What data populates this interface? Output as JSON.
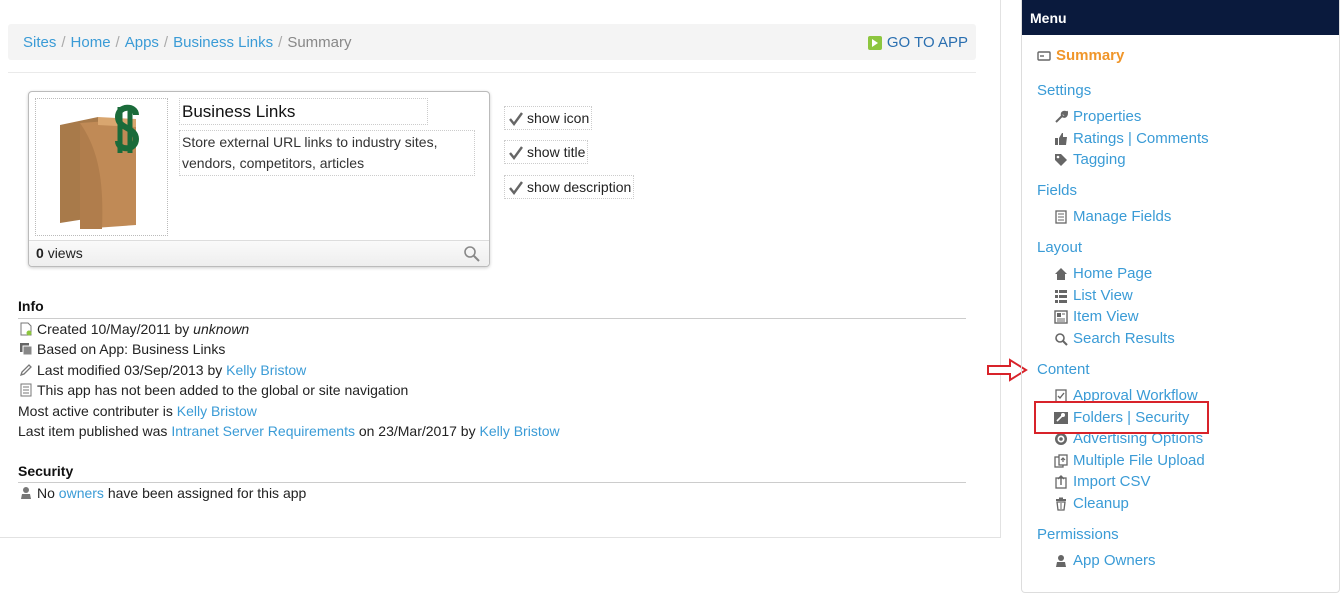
{
  "breadcrumb": {
    "items": [
      "Sites",
      "Home",
      "Apps",
      "Business Links"
    ],
    "separator": "/",
    "current": "Summary"
  },
  "goto_app_label": "GO TO APP",
  "app": {
    "title": "Business Links",
    "description": "Store external URL links to industry sites, vendors, competitors, articles",
    "views_count": "0",
    "views_label": "views"
  },
  "display_options": [
    {
      "label": "show icon",
      "checked": true
    },
    {
      "label": "show title",
      "checked": true
    },
    {
      "label": "show description",
      "checked": true
    }
  ],
  "info": {
    "title": "Info",
    "created_prefix": "Created 10/May/2011 by",
    "created_by": "unknown",
    "based_on": "Based on App: Business Links",
    "modified_prefix": "Last modified 03/Sep/2013 by",
    "modified_by": "Kelly Bristow",
    "navigation_note": "This app has not been added to the global or site navigation",
    "contributor_prefix": "Most active contributer is",
    "contributor": "Kelly Bristow",
    "published_prefix": "Last item published was",
    "published_item": "Intranet Server Requirements",
    "published_mid": "on 23/Mar/2017 by",
    "published_by": "Kelly Bristow"
  },
  "security": {
    "title": "Security",
    "prefix": "No",
    "owners_link": "owners",
    "suffix": "have been assigned for this app"
  },
  "menu": {
    "title": "Menu",
    "summary": "Summary",
    "settings": {
      "label": "Settings",
      "items": [
        "Properties",
        "Ratings | Comments",
        "Tagging"
      ]
    },
    "fields": {
      "label": "Fields",
      "items": [
        "Manage Fields"
      ]
    },
    "layout": {
      "label": "Layout",
      "items": [
        "Home Page",
        "List View",
        "Item View",
        "Search Results"
      ]
    },
    "content": {
      "label": "Content",
      "items": [
        "Approval Workflow",
        "Folders | Security",
        "Advertising Options",
        "Multiple File Upload",
        "Import CSV",
        "Cleanup"
      ]
    },
    "permissions": {
      "label": "Permissions",
      "items": [
        "App Owners"
      ]
    }
  },
  "colors": {
    "link": "#3a9bd6",
    "menu_header": "#0a1a3d",
    "summary_active": "#f0962a",
    "annotation_red": "#d8232a",
    "go_icon": "#8dc63f"
  }
}
